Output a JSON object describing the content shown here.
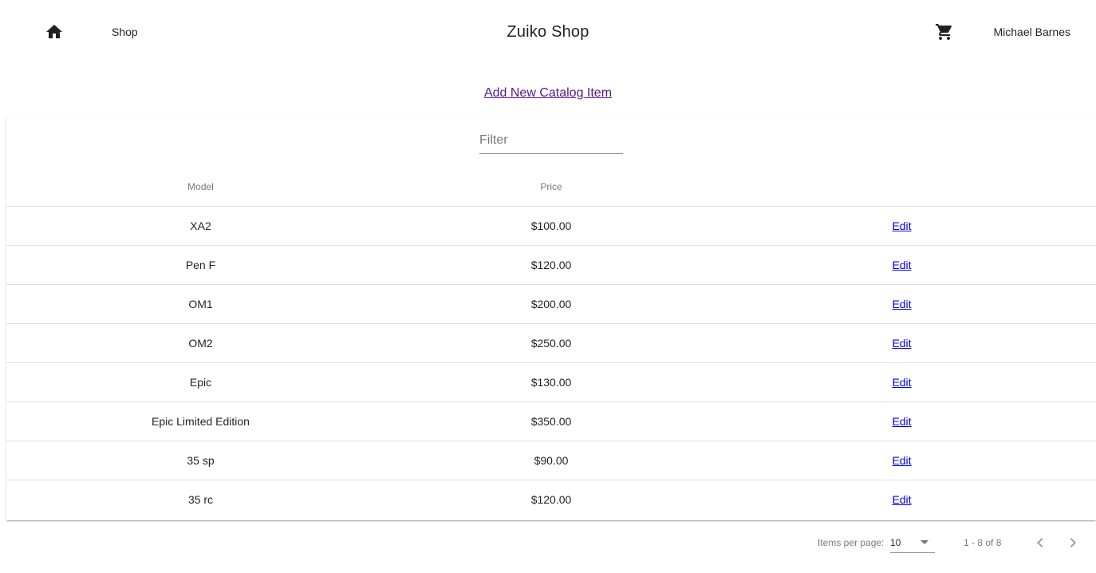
{
  "header": {
    "home_icon": "home-icon",
    "shop_label": "Shop",
    "title": "Zuiko Shop",
    "cart_icon": "shopping-cart-icon",
    "user_name": "Michael Barnes"
  },
  "catalog": {
    "add_link_label": "Add New Catalog Item",
    "filter_placeholder": "Filter",
    "filter_value": "",
    "columns": [
      "Model",
      "Price",
      ""
    ],
    "rows": [
      {
        "model": "XA2",
        "price": "$100.00",
        "action": "Edit"
      },
      {
        "model": "Pen F",
        "price": "$120.00",
        "action": "Edit"
      },
      {
        "model": "OM1",
        "price": "$200.00",
        "action": "Edit"
      },
      {
        "model": "OM2",
        "price": "$250.00",
        "action": "Edit"
      },
      {
        "model": "Epic",
        "price": "$130.00",
        "action": "Edit"
      },
      {
        "model": "Epic Limited Edition",
        "price": "$350.00",
        "action": "Edit"
      },
      {
        "model": "35 sp",
        "price": "$90.00",
        "action": "Edit"
      },
      {
        "model": "35 rc",
        "price": "$120.00",
        "action": "Edit"
      }
    ]
  },
  "paginator": {
    "items_per_page_label": "Items per page:",
    "items_per_page_value": "10",
    "range_label": "1 - 8 of 8",
    "prev_icon": "chevron-left-icon",
    "next_icon": "chevron-right-icon"
  },
  "colors": {
    "visited_link": "#551a8b",
    "link": "#0000ee",
    "text": "#212121",
    "muted": "#757575"
  }
}
